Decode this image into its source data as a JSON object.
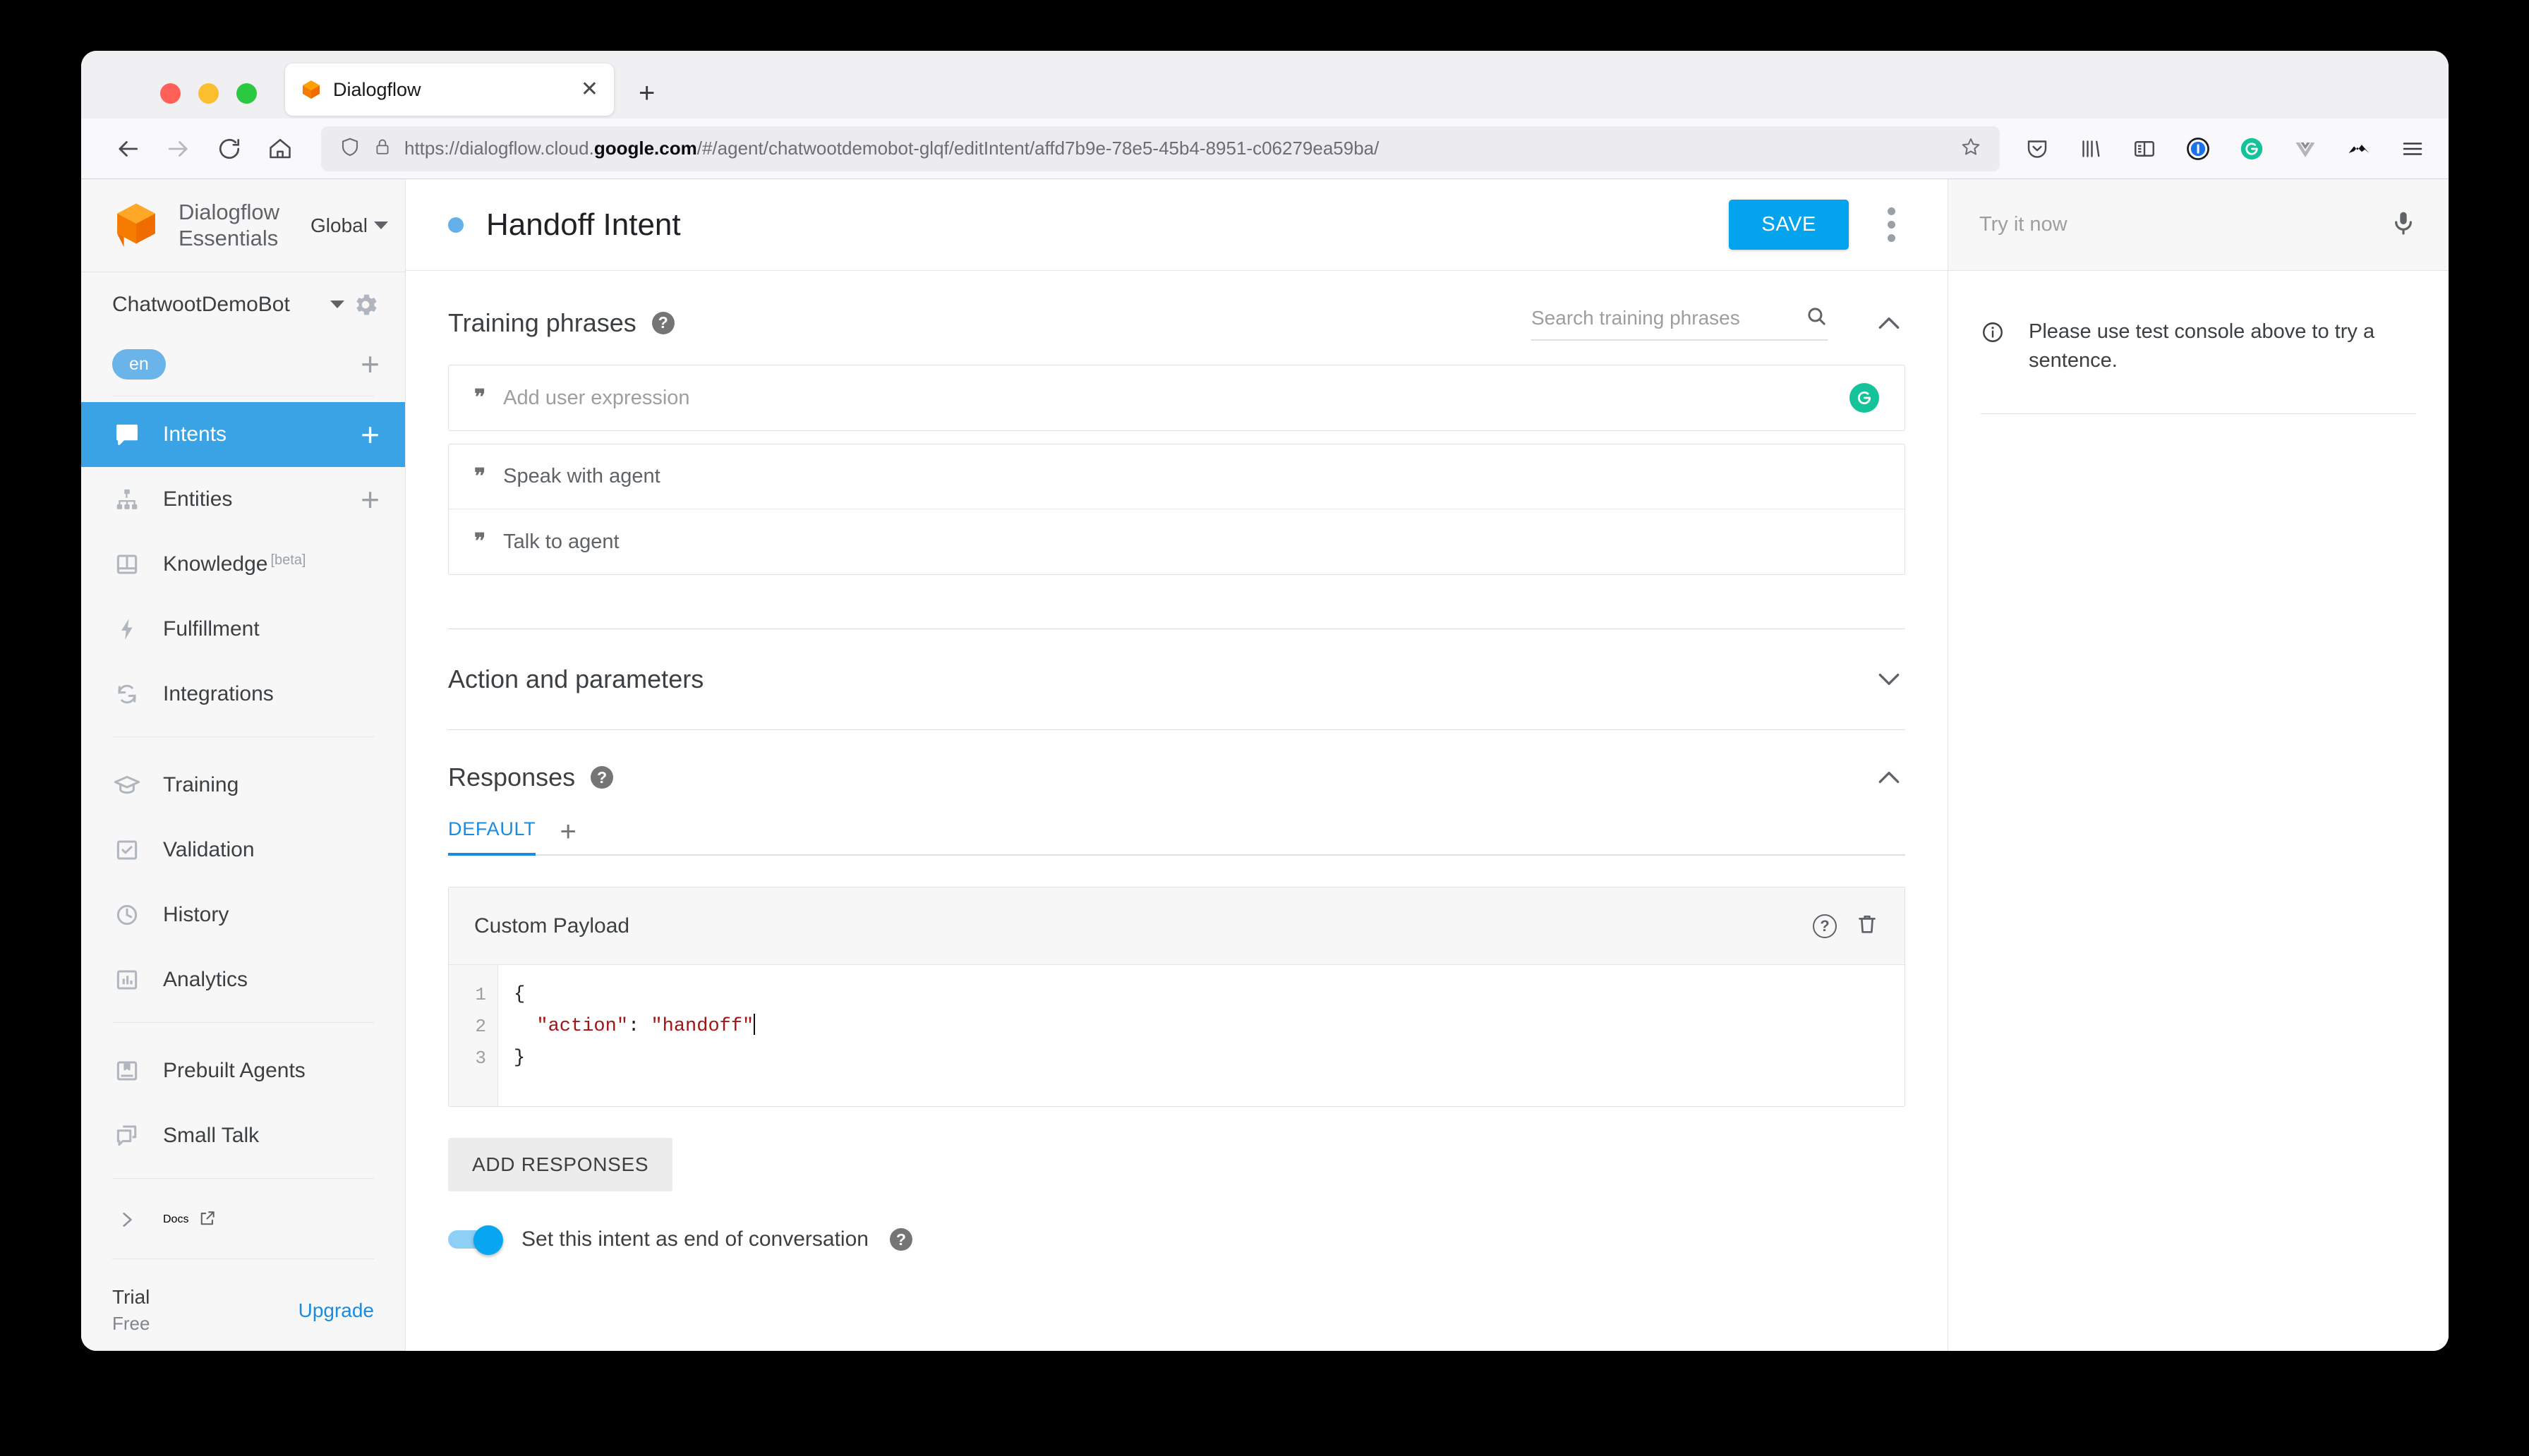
{
  "browser": {
    "tab": {
      "title": "Dialogflow",
      "favicon_icon": "dialogflow-logo-icon",
      "close_icon": "close-icon"
    },
    "new_tab_label": "+",
    "nav": {
      "back_icon": "back-arrow-icon",
      "forward_icon": "forward-arrow-icon",
      "reload_icon": "reload-icon",
      "home_icon": "home-icon"
    },
    "url": {
      "shield_icon": "shield-icon",
      "lock_icon": "lock-icon",
      "prefix": "https://dialogflow.cloud.",
      "highlight": "google.com",
      "suffix": "/#/agent/chatwootdemobot-glqf/editIntent/affd7b9e-78e5-45b4-8951-c06279ea59ba/",
      "bookmark_icon": "star-icon"
    },
    "extensions": [
      {
        "icon": "pocket-icon"
      },
      {
        "icon": "library-icon"
      },
      {
        "icon": "sidebar-icon"
      },
      {
        "icon": "onepassword-icon"
      },
      {
        "icon": "grammarly-icon"
      },
      {
        "icon": "vue-devtools-icon"
      },
      {
        "icon": "mountain-icon"
      },
      {
        "icon": "hamburger-menu-icon"
      }
    ]
  },
  "sidebar": {
    "brand": {
      "line1": "Dialogflow",
      "line2": "Essentials",
      "logo_icon": "dialogflow-logo-icon"
    },
    "region": {
      "label": "Global",
      "chevron_icon": "chevron-down-icon"
    },
    "agent": {
      "name": "ChatwootDemoBot",
      "chevron_icon": "chevron-down-icon",
      "gear_icon": "gear-icon"
    },
    "language": {
      "chip": "en",
      "add_label": "+"
    },
    "items": [
      {
        "label": "Intents",
        "icon": "chat-bubble-icon",
        "active": true,
        "action": "+"
      },
      {
        "label": "Entities",
        "icon": "hierarchy-icon",
        "active": false,
        "action": "+"
      },
      {
        "label": "Knowledge",
        "badge": "[beta]",
        "icon": "book-icon",
        "active": false
      },
      {
        "label": "Fulfillment",
        "icon": "bolt-icon",
        "active": false
      },
      {
        "label": "Integrations",
        "icon": "sync-icon",
        "active": false
      }
    ],
    "items2": [
      {
        "label": "Training",
        "icon": "graduation-cap-icon"
      },
      {
        "label": "Validation",
        "icon": "checkbox-icon"
      },
      {
        "label": "History",
        "icon": "clock-icon"
      },
      {
        "label": "Analytics",
        "icon": "bar-chart-icon"
      }
    ],
    "items3": [
      {
        "label": "Prebuilt Agents",
        "icon": "bookmark-book-icon"
      },
      {
        "label": "Small Talk",
        "icon": "chat-stack-icon"
      }
    ],
    "docs": {
      "label": "Docs",
      "chevron_icon": "chevron-right-icon",
      "external_icon": "external-link-icon"
    },
    "plan": {
      "title": "Trial",
      "subtitle": "Free",
      "upgrade_label": "Upgrade"
    }
  },
  "header": {
    "status_dot_color": "#64b0e8",
    "title": "Handoff Intent",
    "save_label": "SAVE",
    "kebab_icon": "more-vertical-icon"
  },
  "training": {
    "section_title": "Training phrases",
    "help_icon": "help-icon",
    "search_placeholder": "Search training phrases",
    "search_icon": "search-icon",
    "collapse_icon": "chevron-up-icon",
    "new_phrase_placeholder": "Add user expression",
    "grammarly_icon": "grammarly-icon",
    "phrases": [
      {
        "text": "Speak with agent",
        "quote_icon": "quote-icon"
      },
      {
        "text": "Talk to agent",
        "quote_icon": "quote-icon"
      }
    ]
  },
  "action_params": {
    "title": "Action and parameters",
    "expand_icon": "chevron-down-icon"
  },
  "responses": {
    "section_title": "Responses",
    "help_icon": "help-icon",
    "collapse_icon": "chevron-up-icon",
    "tabs": [
      {
        "label": "DEFAULT",
        "selected": true
      }
    ],
    "add_tab_label": "+",
    "payload": {
      "title": "Custom Payload",
      "help_icon": "help-icon",
      "delete_icon": "trash-icon",
      "line_numbers": [
        "1",
        "2",
        "3"
      ],
      "lines": [
        {
          "plain": "{"
        },
        {
          "indent": "  ",
          "key": "\"action\"",
          "sep": ": ",
          "value": "\"handoff\"",
          "cursor": true
        },
        {
          "plain": "}"
        }
      ]
    },
    "add_responses_label": "ADD RESPONSES",
    "end_toggle": {
      "label": "Set this intent as end of conversation",
      "on": true,
      "help_icon": "help-icon"
    }
  },
  "try_panel": {
    "placeholder": "Try it now",
    "mic_icon": "microphone-icon",
    "info_icon": "info-icon",
    "info_text": "Please use test console above to try a sentence."
  },
  "colors": {
    "accent_blue": "#03a3ee",
    "sidebar_active": "#39a3e5",
    "link_blue": "#1a8ce0",
    "grammarly_green": "#15c39a",
    "code_string_red": "#a31515"
  }
}
